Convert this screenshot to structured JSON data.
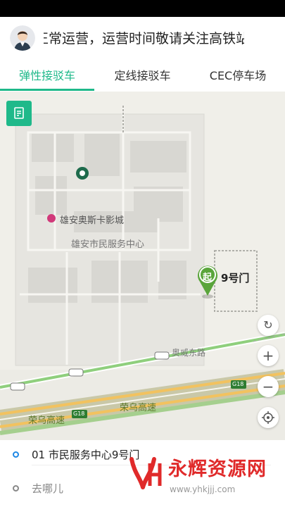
{
  "notice": {
    "text": "正常运营，运营时间敬请关注高铁站"
  },
  "tabs": [
    {
      "label": "弹性接驳车",
      "active": true
    },
    {
      "label": "定线接驳车",
      "active": false
    },
    {
      "label": "CEC停车场",
      "active": false
    }
  ],
  "map": {
    "poi_cinema": "雄安奥斯卡影城",
    "poi_center": "雄安市民服务中心",
    "road_east": "奥威东路",
    "road_highway": "荣乌高速",
    "highway_code": "G18",
    "pin_label": "起",
    "gate_label": "9号门"
  },
  "controls": {
    "zoom_in": "+",
    "zoom_out": "−"
  },
  "trip": {
    "origin": "01 市民服务中心9号门",
    "destination_placeholder": "去哪儿"
  },
  "watermark": {
    "text": "永辉资源网",
    "url": "www.yhkjjj.com"
  },
  "colors": {
    "accent": "#1fb98a",
    "origin_dot": "#1e88e5",
    "watermark": "#e02a2a"
  }
}
